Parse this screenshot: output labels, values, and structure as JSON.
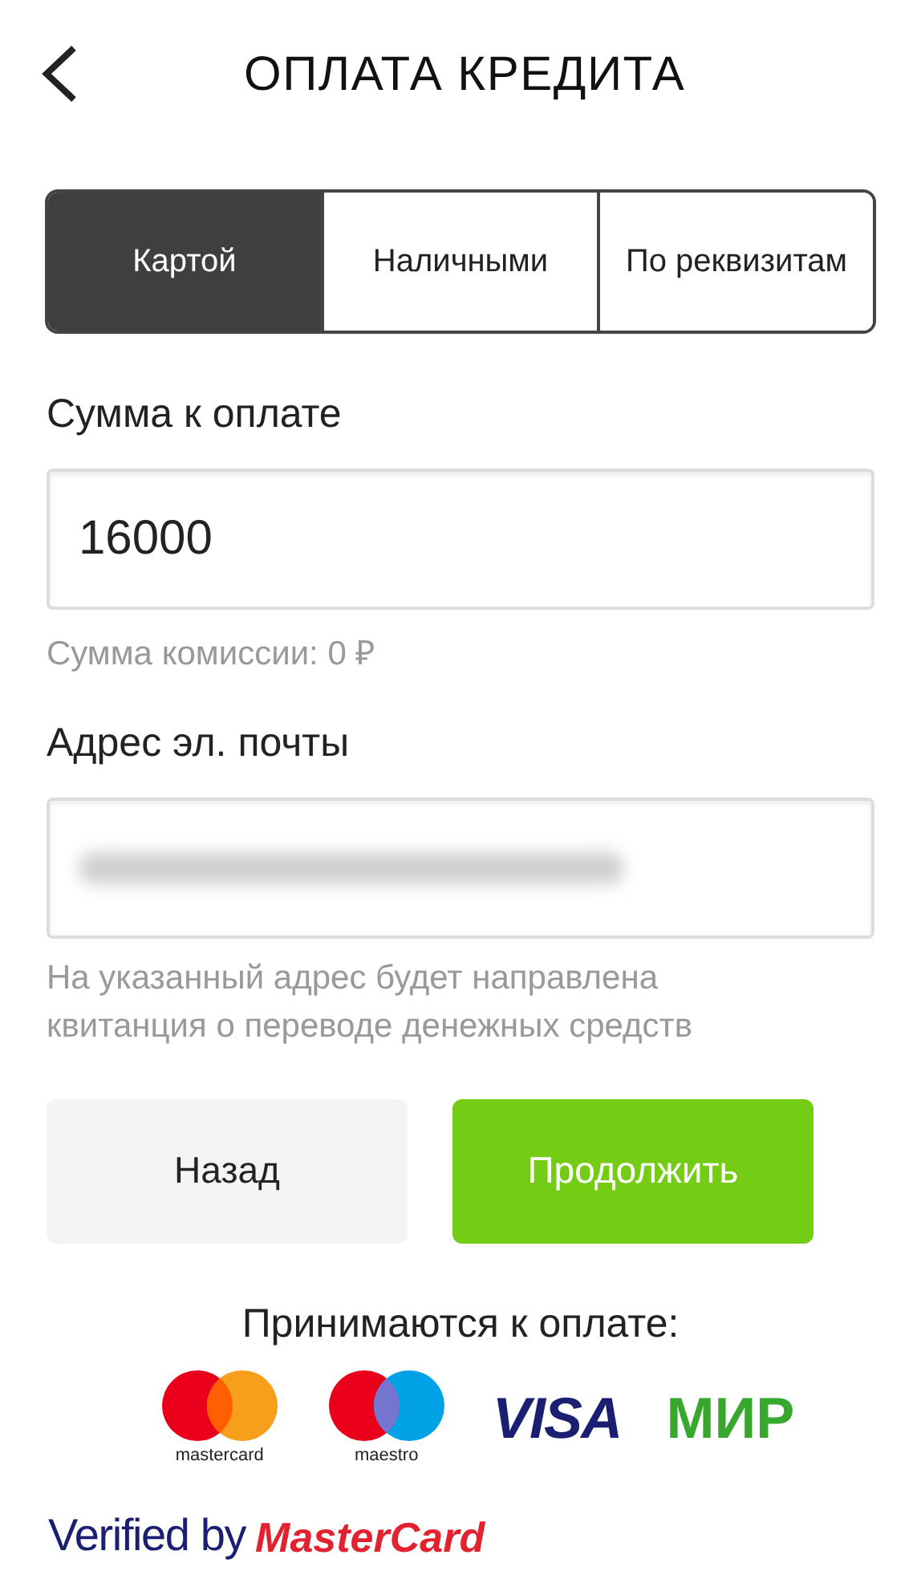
{
  "header": {
    "title": "ОПЛАТА КРЕДИТА"
  },
  "tabs": [
    {
      "label": "Картой",
      "selected": true
    },
    {
      "label": "Наличными",
      "selected": false
    },
    {
      "label": "По реквизитам",
      "selected": false
    }
  ],
  "amount": {
    "label": "Сумма к оплате",
    "value": "16000",
    "note": "Сумма комиссии: 0 ₽"
  },
  "email": {
    "label": "Адрес эл. почты",
    "redacted": true,
    "note": "На указанный адрес будет направлена квитанция о переводе денежных средств"
  },
  "buttons": [
    {
      "label": "Назад",
      "kind": "secondary"
    },
    {
      "label": "Продолжить",
      "kind": "primary"
    }
  ],
  "accepted": {
    "title": "Принимаются к оплате:",
    "logos": [
      {
        "kind": "mastercard",
        "label": "mastercard"
      },
      {
        "kind": "maestro",
        "label": "maestro"
      },
      {
        "kind": "visa",
        "label": "VISA"
      },
      {
        "kind": "mir",
        "label": "МИР"
      }
    ]
  },
  "badges": [
    {
      "kind": "verified",
      "label": "Verified by"
    },
    {
      "kind": "securecode",
      "label": "MasterCard"
    }
  ]
}
